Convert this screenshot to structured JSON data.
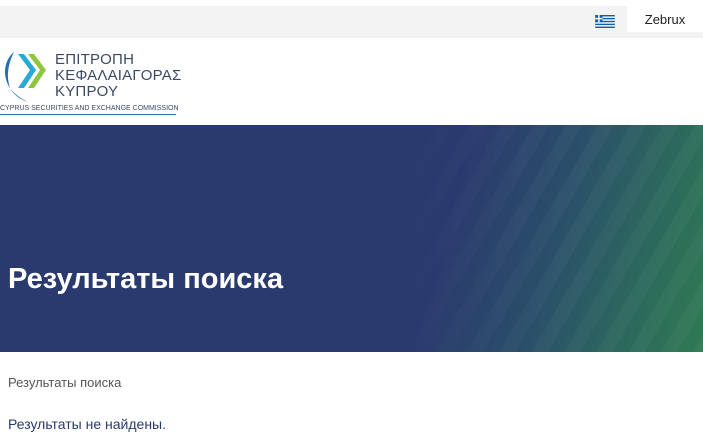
{
  "topbar": {
    "language_icon": "greek-flag-icon",
    "user_label": "Zebrux"
  },
  "logo": {
    "line1": "ΕΠΙΤΡΟΠΗ",
    "line2": "ΚΕΦΑΛΑΙΑΓΟΡΑΣ",
    "line3": "ΚΥΠΡΟΥ",
    "subtitle": "CYPRUS SECURITIES AND EXCHANGE COMMISSION"
  },
  "hero": {
    "title": "Результаты поиска"
  },
  "breadcrumb": {
    "current": "Результаты поиска"
  },
  "results": {
    "message": "Результаты не найдены."
  },
  "colors": {
    "hero_primary": "#2b3a6e",
    "hero_accent": "#2f7a52",
    "topbar_bg": "#f4f3f4"
  }
}
